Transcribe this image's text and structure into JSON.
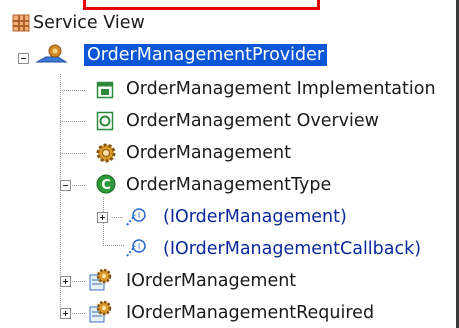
{
  "tree": {
    "root": {
      "label": "Service View",
      "icon": "service-view-icon"
    },
    "provider": {
      "label": "OrderManagementProvider",
      "icon": "provider-icon",
      "selected": true,
      "expanded": true
    },
    "children": [
      {
        "label": "OrderManagement Implementation",
        "icon": "implementation-icon"
      },
      {
        "label": "OrderManagement Overview",
        "icon": "overview-icon"
      },
      {
        "label": "OrderManagement",
        "icon": "operation-gear-icon"
      },
      {
        "label": "OrderManagementType",
        "icon": "type-c-icon",
        "expanded": true,
        "children": [
          {
            "label": "(IOrderManagement)",
            "icon": "interface-link-icon",
            "expandable": true
          },
          {
            "label": "(IOrderManagementCallback)",
            "icon": "interface-link-icon",
            "expandable": false
          }
        ]
      },
      {
        "label": "IOrderManagement",
        "icon": "interface-gear-icon",
        "expandable": true
      },
      {
        "label": "IOrderManagementRequired",
        "icon": "interface-gear-icon",
        "expandable": true
      }
    ]
  },
  "colors": {
    "selection": "#0a56d6",
    "highlight_border": "#e60000",
    "link_text": "#0a2a9c"
  }
}
